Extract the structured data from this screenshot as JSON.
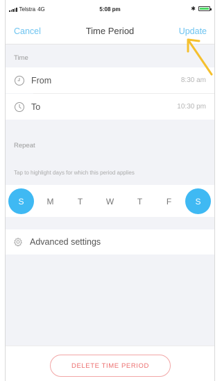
{
  "status_bar": {
    "carrier": "Telstra",
    "network": "4G",
    "time": "5:08 pm"
  },
  "nav": {
    "cancel_label": "Cancel",
    "title": "Time Period",
    "update_label": "Update"
  },
  "time_section": {
    "header": "Time",
    "from": {
      "label": "From",
      "value": "8:30 am"
    },
    "to": {
      "label": "To",
      "value": "10:30 pm"
    }
  },
  "repeat_section": {
    "header": "Repeat",
    "hint": "Tap to highlight days for which this period applies",
    "days": [
      {
        "letter": "S",
        "selected": true
      },
      {
        "letter": "M",
        "selected": false
      },
      {
        "letter": "T",
        "selected": false
      },
      {
        "letter": "W",
        "selected": false
      },
      {
        "letter": "T",
        "selected": false
      },
      {
        "letter": "F",
        "selected": false
      },
      {
        "letter": "S",
        "selected": true
      }
    ]
  },
  "advanced": {
    "label": "Advanced settings",
    "icon": "gear-icon"
  },
  "footer": {
    "delete_label": "DELETE TIME PERIOD"
  },
  "colors": {
    "accent": "#3fb9f3",
    "link": "#6cc3f0",
    "danger": "#ec6f6f",
    "annotation_arrow": "#f5c02e"
  }
}
